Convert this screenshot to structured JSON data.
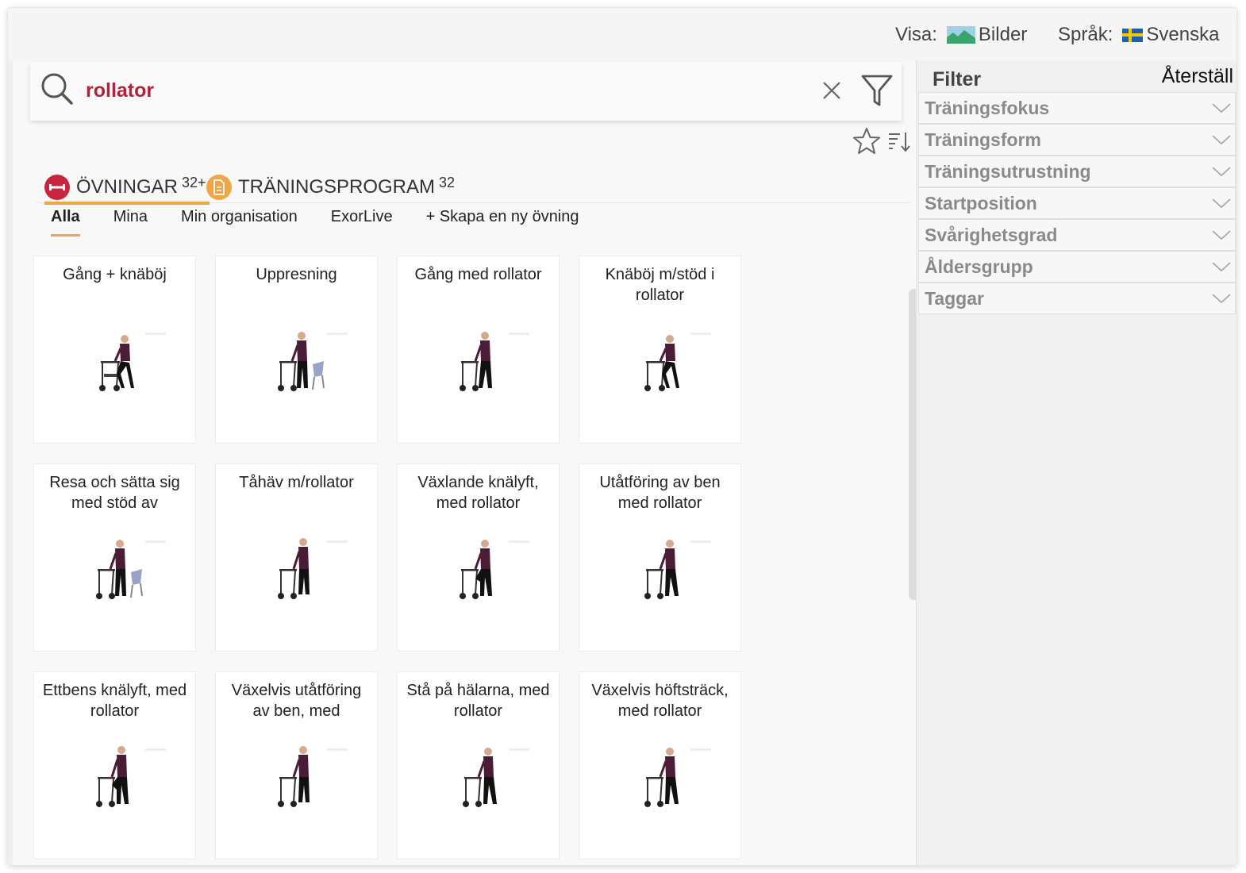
{
  "topbar": {
    "visa_label": "Visa:",
    "visa_value": "Bilder",
    "sprak_label": "Språk:",
    "sprak_value": "Svenska"
  },
  "search": {
    "query": "rollator"
  },
  "categories": [
    {
      "label": "ÖVNINGAR",
      "count": "32+",
      "color": "#c8243d"
    },
    {
      "label": "TRÄNINGSPROGRAM",
      "count": "32",
      "color": "#f0a547"
    }
  ],
  "subtabs": [
    "Alla",
    "Mina",
    "Min organisation",
    "ExorLive",
    "+ Skapa en ny övning"
  ],
  "exercises": [
    {
      "title": "Gång + knäböj"
    },
    {
      "title": "Uppresning"
    },
    {
      "title": "Gång med rollator"
    },
    {
      "title": "Knäböj m/stöd i rollator"
    },
    {
      "title": "Resa och sätta sig med stöd av"
    },
    {
      "title": "Tåhäv m/rollator"
    },
    {
      "title": "Växlande knälyft, med rollator"
    },
    {
      "title": "Utåtföring av ben med rollator"
    },
    {
      "title": "Ettbens knälyft, med rollator"
    },
    {
      "title": "Växelvis utåtföring av ben, med"
    },
    {
      "title": "Stå på hälarna, med rollator"
    },
    {
      "title": "Växelvis höftsträck, med rollator"
    }
  ],
  "filter": {
    "title": "Filter",
    "reset": "Återställ",
    "items": [
      "Träningsfokus",
      "Träningsform",
      "Träningsutrustning",
      "Startposition",
      "Svårighetsgrad",
      "Åldersgrupp",
      "Taggar"
    ]
  },
  "colors": {
    "accent": "#f0a547",
    "brand_red": "#c8243d",
    "query_text": "#b0243b"
  }
}
